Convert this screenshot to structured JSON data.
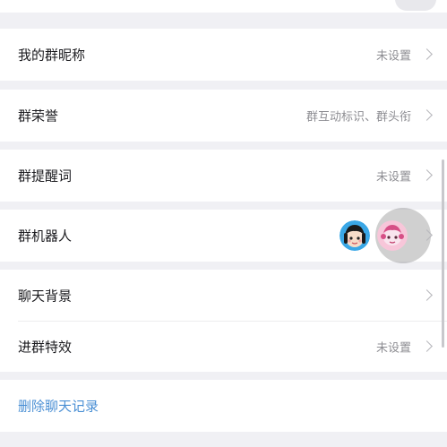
{
  "settings": {
    "group_nickname": {
      "label": "我的群昵称",
      "value": "未设置"
    },
    "group_honor": {
      "label": "群荣誉",
      "value": "群互动标识、群头衔"
    },
    "group_reminder": {
      "label": "群提醒词",
      "value": "未设置"
    },
    "group_robot": {
      "label": "群机器人",
      "icons": [
        "robot-avatar-girl-icon",
        "robot-avatar-pink-icon"
      ]
    },
    "chat_background": {
      "label": "聊天背景"
    },
    "group_effects": {
      "label": "进群特效",
      "value": "未设置"
    },
    "delete_chat": {
      "label": "删除聊天记录"
    }
  },
  "colors": {
    "background": "#f0f0f4",
    "card": "#ffffff",
    "primary_text": "#1b1b1f",
    "secondary_text": "#8e8e93",
    "link": "#4a8fd4"
  }
}
